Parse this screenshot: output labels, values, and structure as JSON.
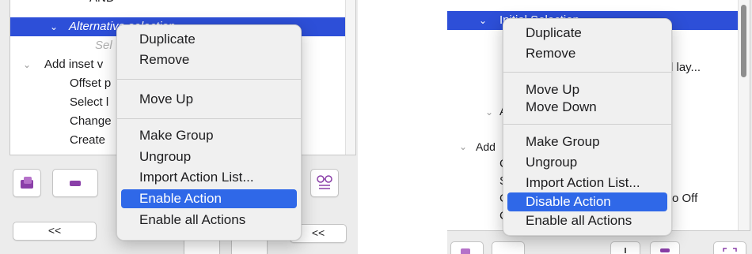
{
  "colors": {
    "selection_blue": "#2d4fd8",
    "menu_highlight": "#2f68e8",
    "menu_background": "#f0f0f0",
    "panel_background": "#ececec",
    "icon_purple": "#8a3fa8"
  },
  "left": {
    "tree": {
      "top_partial": "AND",
      "selected_row": "Alternative selection",
      "placeholder": "Sel",
      "group_label": "Add inset v",
      "children": [
        "Offset p",
        "Select l",
        "Change",
        "Create"
      ]
    },
    "toolbar": {
      "icon_button_1": "add-action-icon",
      "icon_button_2": "remove-action-icon",
      "icon_button_3": "action-list-icon",
      "prev_label": "<<",
      "next_label": "<<"
    },
    "menu": {
      "items_group1": [
        "Duplicate",
        "Remove"
      ],
      "items_group2": [
        "Move Up"
      ],
      "items_group3": [
        "Make Group",
        "Ungroup",
        "Import Action List...",
        "Enable Action",
        "Enable all Actions"
      ],
      "highlighted": "Enable Action"
    }
  },
  "right": {
    "tree": {
      "selected_row": "Initial Selection",
      "row_tail_1": "l lay...",
      "row_partial_a": "A",
      "group_label": "Add",
      "child_letters": [
        "C",
        "S",
        "C",
        "C"
      ],
      "row_tail_2": "o Off"
    },
    "menu": {
      "items_group1": [
        "Duplicate",
        "Remove"
      ],
      "items_group2": [
        "Move Up",
        "Move Down"
      ],
      "items_group3": [
        "Make Group",
        "Ungroup",
        "Import Action List...",
        "Disable Action",
        "Enable all Actions"
      ],
      "highlighted": "Disable Action"
    }
  }
}
